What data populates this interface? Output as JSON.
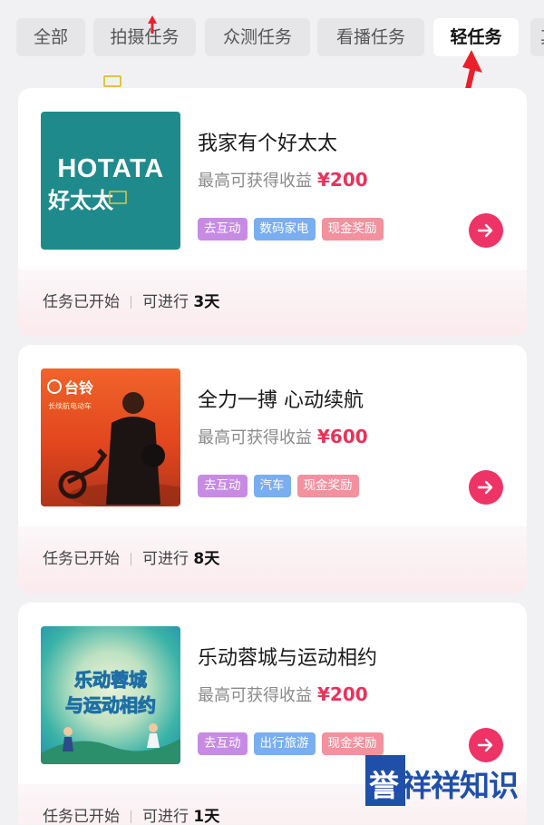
{
  "tabs": [
    "全部",
    "拍摄任务",
    "众测任务",
    "看播任务",
    "轻任务",
    "其他"
  ],
  "active_tab": "轻任务",
  "earn_label": "最高可获得收益",
  "status_label": "任务已开始",
  "duration_prefix": "可进行",
  "cards": [
    {
      "title": "我家有个好太太",
      "reward": "¥200",
      "tags": [
        "去互动",
        "数码家电",
        "现金奖励"
      ],
      "days": "3天",
      "thumb_text_1": "HOTATA",
      "thumb_text_2": "好太太"
    },
    {
      "title": "全力一搏 心动续航",
      "reward": "¥600",
      "tags": [
        "去互动",
        "汽车",
        "现金奖励"
      ],
      "days": "8天",
      "thumb_text_1": "台铃",
      "thumb_text_2": "长续航电动车"
    },
    {
      "title": "乐动蓉城与运动相约",
      "reward": "¥200",
      "tags": [
        "去互动",
        "出行旅游",
        "现金奖励"
      ],
      "days": "1天",
      "thumb_text_1": "乐动蓉城",
      "thumb_text_2": "与运动相约"
    }
  ],
  "watermark": {
    "part1": "誉",
    "part2": "祥祥知识"
  },
  "colors": {
    "accent": "#ee3366",
    "reward": "#e8335c",
    "tag_purple": "#c88be4",
    "tag_blue": "#79aef0",
    "tag_pink": "#f3919f"
  },
  "icons": {
    "go": "arrow-right-icon",
    "annotation": "red-arrow-icon"
  }
}
